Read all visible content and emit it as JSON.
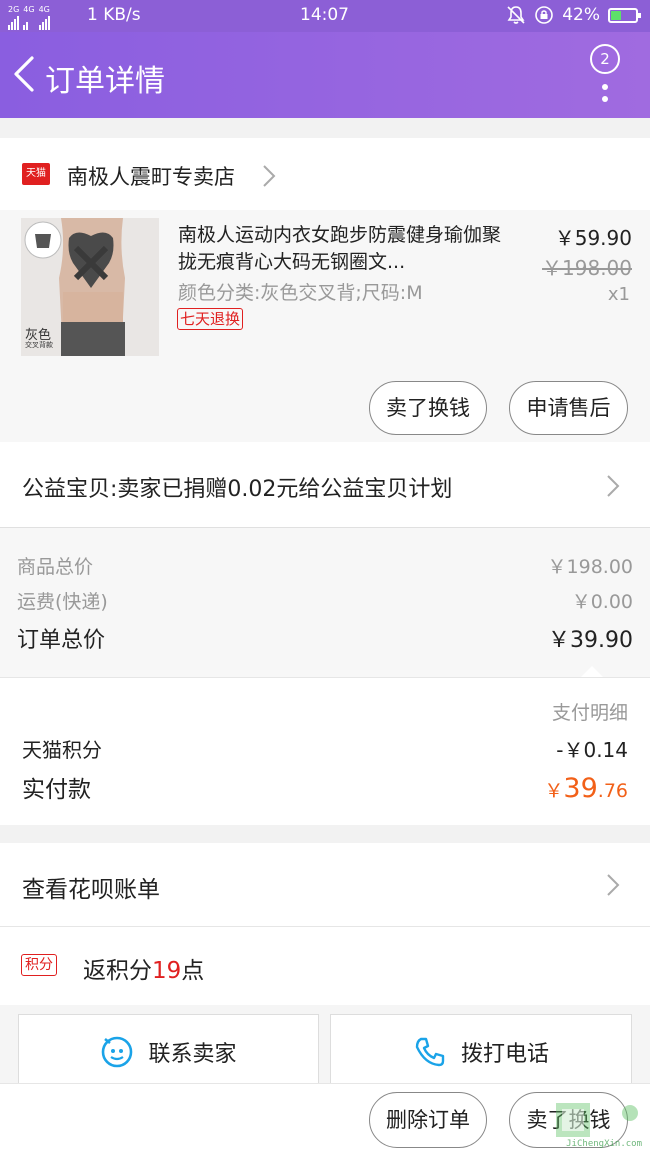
{
  "status_bar": {
    "network_tags": [
      "2G",
      "4G",
      "4G"
    ],
    "speed": "1 KB/s",
    "time": "14:07",
    "battery": "42%",
    "battery_level": 0.42
  },
  "header": {
    "title": "订单详情",
    "notification_count": "2"
  },
  "store": {
    "badge": "天猫",
    "name": "南极人震町专卖店"
  },
  "product": {
    "image_label": "灰色",
    "image_sublabel": "交叉背款",
    "name": "南极人运动内衣女跑步防震健身瑜伽聚拢无痕背心大码无钢圈文...",
    "spec": "颜色分类:灰色交叉背;尺码:M",
    "return_badge": "七天退换",
    "price": "￥59.90",
    "original_price": "￥198.00",
    "quantity": "x1",
    "sell_button": "卖了换钱",
    "aftersale_button": "申请售后"
  },
  "charity": {
    "text": "公益宝贝:卖家已捐赠0.02元给公益宝贝计划"
  },
  "summary": {
    "goods_label": "商品总价",
    "goods_value": "￥198.00",
    "shipping_label": "运费(快递)",
    "shipping_value": "￥0.00",
    "total_label": "订单总价",
    "total_value": "￥39.90"
  },
  "payment": {
    "detail_label": "支付明细",
    "points_label": "天猫积分",
    "points_value": "-￥0.14",
    "paid_label": "实付款",
    "paid_currency": "￥",
    "paid_integer": "39",
    "paid_decimal": ".76",
    "accent_color": "#f26018"
  },
  "huabei": {
    "text": "查看花呗账单"
  },
  "points_reward": {
    "tag": "积分",
    "prefix": "返积分",
    "number": "19",
    "suffix": "点"
  },
  "contact": {
    "seller_button": "联系卖家",
    "phone_button": "拨打电话"
  },
  "bottom_bar": {
    "delete_button": "删除订单",
    "sell_button": "卖了换钱"
  },
  "watermark": {
    "text": "JiChengXin.com"
  },
  "colors": {
    "header_purple": "#8c5fd6",
    "tmall_red": "#e02020",
    "contact_icon_blue": "#1aa3e8"
  }
}
